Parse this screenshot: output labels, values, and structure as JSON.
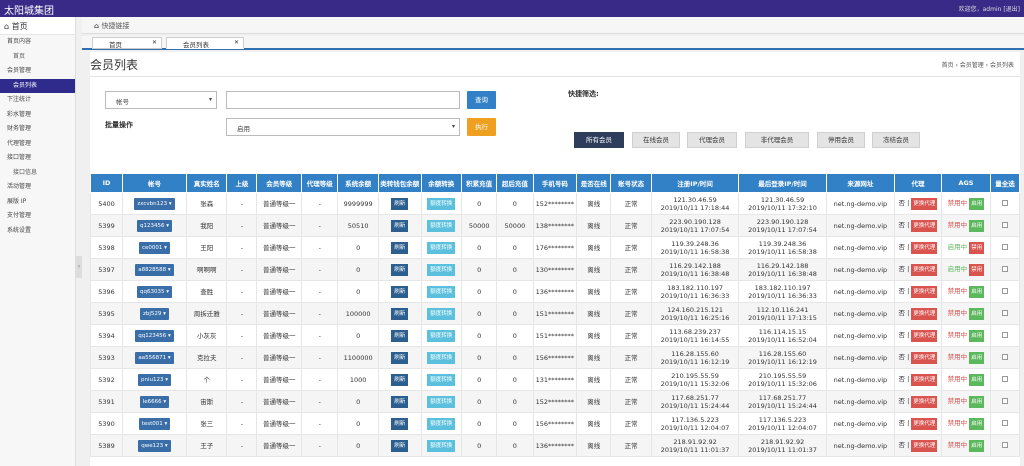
{
  "app": {
    "brand": "太阳城集团",
    "welcome": "欢迎您，admin [退出]"
  },
  "sidebar": {
    "home": "首页",
    "items": [
      {
        "label": "首页内容",
        "sub": false,
        "active": false
      },
      {
        "label": "首页",
        "sub": true,
        "active": false
      },
      {
        "label": "会员管理",
        "sub": false,
        "active": false
      },
      {
        "label": "会员列表",
        "sub": true,
        "active": true
      },
      {
        "label": "下注统计",
        "sub": false,
        "active": false
      },
      {
        "label": "彩水管理",
        "sub": false,
        "active": false
      },
      {
        "label": "财务管理",
        "sub": false,
        "active": false
      },
      {
        "label": "代理管理",
        "sub": false,
        "active": false
      },
      {
        "label": "接口管理",
        "sub": false,
        "active": false
      },
      {
        "label": "接口信息",
        "sub": true,
        "active": false
      },
      {
        "label": "活动管理",
        "sub": false,
        "active": false
      },
      {
        "label": "展版 IP",
        "sub": false,
        "active": false
      },
      {
        "label": "支付管理",
        "sub": false,
        "active": false
      },
      {
        "label": "系统设置",
        "sub": false,
        "active": false
      }
    ]
  },
  "breadbar": {
    "label": "快捷链接"
  },
  "tabs": [
    {
      "label": "首页"
    },
    {
      "label": "会员列表"
    }
  ],
  "page": {
    "title": "会员列表",
    "crumb": "首页  ›  会员管理  ›  会员列表"
  },
  "filter": {
    "field_select": "帐号",
    "search_value": "",
    "search_btn": "查询",
    "batch_label": "批量操作",
    "batch_select": "启用",
    "exec_btn": "执行",
    "quick_label": "快捷筛选:",
    "quick": [
      "所有会员",
      "在线会员",
      "代理会员",
      "非代理会员",
      "停用会员",
      "冻结会员"
    ]
  },
  "table": {
    "headers": [
      "ID",
      "帐号",
      "真实姓名",
      "上级",
      "会员等级",
      "代理等级",
      "系统余额",
      "类转钱包余额",
      "余额转换",
      "积累充值",
      "超后充值",
      "手机号码",
      "是否在线",
      "账号状态",
      "注册IP/时间",
      "最后登录IP/时间",
      "来源网址",
      "代理",
      "AGS",
      "量全选"
    ],
    "refresh": "刷新",
    "lock": "额度转换",
    "proxy_no": "否",
    "change_proxy": "更换代理",
    "banned": "禁用中",
    "enable": "启用",
    "enabled": "启用中",
    "disable": "禁用",
    "rows": [
      {
        "id": "5400",
        "acc": "zxcvbn123",
        "name": "张森",
        "up": "-",
        "level": "普通等级一",
        "plevel": "-",
        "bal": "9999999",
        "charge": "0",
        "last": "0",
        "phone": "152********",
        "online": "离线",
        "status": "正常",
        "reg_ip": "121.30.46.59",
        "reg_t": "2019/10/11 17:18:44",
        "log_ip": "121.30.46.59",
        "log_t": "2019/10/11 17:32:10",
        "src": "net.ng-demo.vip",
        "ags": "b"
      },
      {
        "id": "5399",
        "acc": "q123456",
        "name": "我阳",
        "up": "-",
        "level": "普通等级一",
        "plevel": "-",
        "bal": "50510",
        "charge": "50000",
        "last": "50000",
        "phone": "138********",
        "online": "离线",
        "status": "正常",
        "reg_ip": "223.90.190.128",
        "reg_t": "2019/10/11 17:07:54",
        "log_ip": "223.90.190.128",
        "log_t": "2019/10/11 17:07:54",
        "src": "net.ng-demo.vip",
        "ags": "b"
      },
      {
        "id": "5398",
        "acc": "ce0001",
        "name": "王阳",
        "up": "-",
        "level": "普通等级一",
        "plevel": "-",
        "bal": "0",
        "charge": "0",
        "last": "0",
        "phone": "176********",
        "online": "离线",
        "status": "正常",
        "reg_ip": "119.39.248.36",
        "reg_t": "2019/10/11 16:58:38",
        "log_ip": "119.39.248.36",
        "log_t": "2019/10/11 16:58:38",
        "src": "net.ng-demo.vip",
        "ags": "a"
      },
      {
        "id": "5397",
        "acc": "a8828588",
        "name": "啊啊啊",
        "up": "-",
        "level": "普通等级一",
        "plevel": "-",
        "bal": "0",
        "charge": "0",
        "last": "0",
        "phone": "130********",
        "online": "离线",
        "status": "正常",
        "reg_ip": "116.29.142.188",
        "reg_t": "2019/10/11 16:38:48",
        "log_ip": "116.29.142.188",
        "log_t": "2019/10/11 16:38:48",
        "src": "net.ng-demo.vip",
        "ags": "a"
      },
      {
        "id": "5396",
        "acc": "qq63035",
        "name": "查胜",
        "up": "-",
        "level": "普通等级一",
        "plevel": "-",
        "bal": "0",
        "charge": "0",
        "last": "0",
        "phone": "136********",
        "online": "离线",
        "status": "正常",
        "reg_ip": "183.182.110.197",
        "reg_t": "2019/10/11 16:36:33",
        "log_ip": "183.182.110.197",
        "log_t": "2019/10/11 16:36:33",
        "src": "net.ng-demo.vip",
        "ags": "b"
      },
      {
        "id": "5395",
        "acc": "zbj529",
        "name": "周拆迁雅",
        "up": "-",
        "level": "普通等级一",
        "plevel": "-",
        "bal": "100000",
        "charge": "0",
        "last": "0",
        "phone": "151********",
        "online": "离线",
        "status": "正常",
        "reg_ip": "124.160.215.121",
        "reg_t": "2019/10/11 16:25:16",
        "log_ip": "112.10.116.241",
        "log_t": "2019/10/11 17:13:15",
        "src": "net.ng-demo.vip",
        "ags": "b"
      },
      {
        "id": "5394",
        "acc": "qq123456",
        "name": "小灰灰",
        "up": "-",
        "level": "普通等级一",
        "plevel": "-",
        "bal": "0",
        "charge": "0",
        "last": "0",
        "phone": "151********",
        "online": "离线",
        "status": "正常",
        "reg_ip": "113.68.239.237",
        "reg_t": "2019/10/11 16:14:55",
        "log_ip": "116.114.15.15",
        "log_t": "2019/10/11 16:52:04",
        "src": "net.ng-demo.vip",
        "ags": "b"
      },
      {
        "id": "5393",
        "acc": "aa556871",
        "name": "克拉夫",
        "up": "-",
        "level": "普通等级一",
        "plevel": "-",
        "bal": "1100000",
        "charge": "0",
        "last": "0",
        "phone": "156********",
        "online": "离线",
        "status": "正常",
        "reg_ip": "116.28.155.60",
        "reg_t": "2019/10/11 16:12:19",
        "log_ip": "116.28.155.60",
        "log_t": "2019/10/11 16:12:19",
        "src": "net.ng-demo.vip",
        "ags": "b"
      },
      {
        "id": "5392",
        "acc": "pniu123",
        "name": "个",
        "up": "-",
        "level": "普通等级一",
        "plevel": "-",
        "bal": "1000",
        "charge": "0",
        "last": "0",
        "phone": "131********",
        "online": "离线",
        "status": "正常",
        "reg_ip": "210.195.55.59",
        "reg_t": "2019/10/11 15:32:06",
        "log_ip": "210.195.55.59",
        "log_t": "2019/10/11 15:32:06",
        "src": "net.ng-demo.vip",
        "ags": "b"
      },
      {
        "id": "5391",
        "acc": "le6666",
        "name": "宙斯",
        "up": "-",
        "level": "普通等级一",
        "plevel": "-",
        "bal": "0",
        "charge": "0",
        "last": "0",
        "phone": "152********",
        "online": "离线",
        "status": "正常",
        "reg_ip": "117.68.251.77",
        "reg_t": "2019/10/11 15:24:44",
        "log_ip": "117.68.251.77",
        "log_t": "2019/10/11 15:24:44",
        "src": "net.ng-demo.vip",
        "ags": "b"
      },
      {
        "id": "5390",
        "acc": "test001",
        "name": "张三",
        "up": "-",
        "level": "普通等级一",
        "plevel": "-",
        "bal": "0",
        "charge": "0",
        "last": "0",
        "phone": "156********",
        "online": "离线",
        "status": "正常",
        "reg_ip": "117.136.5.223",
        "reg_t": "2019/10/11 12:04:07",
        "log_ip": "117.136.5.223",
        "log_t": "2019/10/11 12:04:07",
        "src": "net.ng-demo.vip",
        "ags": "b"
      },
      {
        "id": "5389",
        "acc": "qwe123",
        "name": "王子",
        "up": "-",
        "level": "普通等级一",
        "plevel": "-",
        "bal": "0",
        "charge": "0",
        "last": "0",
        "phone": "136********",
        "online": "离线",
        "status": "正常",
        "reg_ip": "218.91.92.92",
        "reg_t": "2019/10/11 11:01:37",
        "log_ip": "218.91.92.92",
        "log_t": "2019/10/11 11:01:37",
        "src": "net.ng-demo.vip",
        "ags": "b"
      }
    ]
  }
}
